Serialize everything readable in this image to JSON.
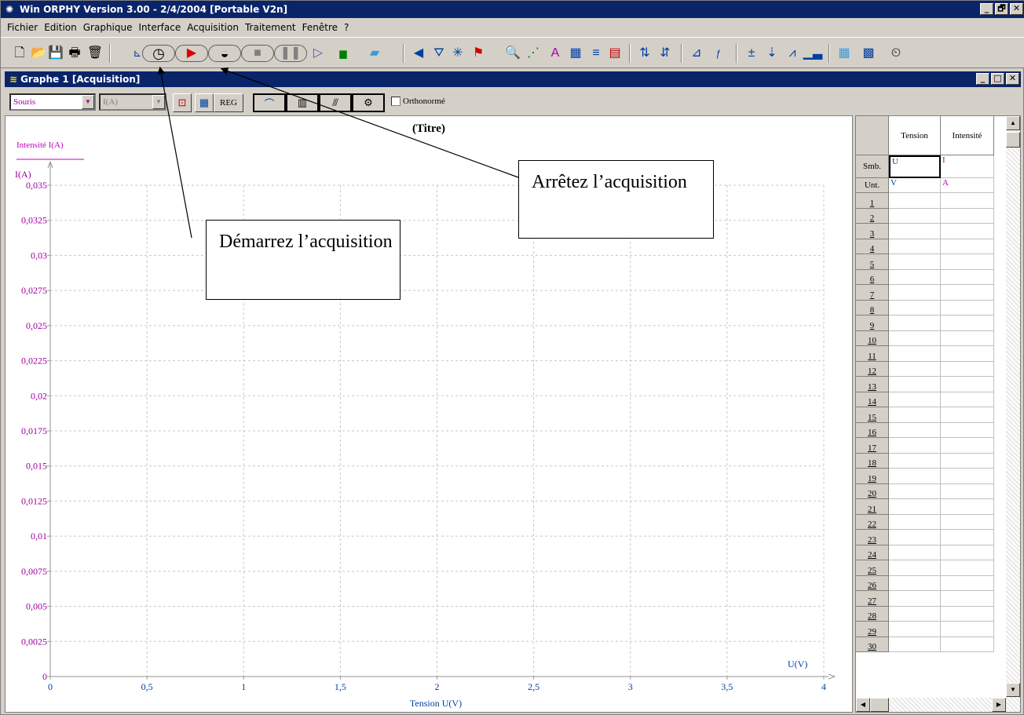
{
  "window": {
    "title": "Win ORPHY Version 3.00 - 2/4/2004  [Portable V2n]",
    "buttons": [
      "_",
      "🗗",
      "✕"
    ]
  },
  "menu": [
    "Fichier",
    "Edition",
    "Graphique",
    "Interface",
    "Acquisition",
    "Traitement",
    "Fenêtre",
    "?"
  ],
  "toolbar": {
    "icons": [
      "new-icon",
      "open-icon",
      "save-icon",
      "print-icon",
      "trash-icon",
      "start-acquisition-icon",
      "play-icon",
      "stop-acquisition-icon",
      "stop-icon",
      "pause-icon",
      "step-icon",
      "display-icon",
      "calibrate-icon",
      "cursor-icon",
      "marker-icon",
      "star-icon",
      "flag-icon",
      "zoom-icon",
      "model-icon",
      "text-icon",
      "table-icon",
      "equation-icon",
      "scale-icon",
      "derive-icon",
      "integrate-icon",
      "chart-icon",
      "function-icon",
      "calc-icon",
      "sort-icon",
      "curve-icon",
      "histogram-icon",
      "grid-icon",
      "clock-icon"
    ]
  },
  "graph_window": {
    "title": "Graphe 1 [Acquisition]",
    "mode_select": "Souris",
    "variable_select": "I(A)",
    "reg_label": "REG",
    "orthonormal_label": "Orthonormé"
  },
  "chart_data": {
    "type": "scatter",
    "title": "(Titre)",
    "xlabel": "Tension U(V)",
    "ylabel": "Intensité I(A)",
    "x_unit_label": "U(V)",
    "y_unit_label": "I(A)",
    "xlim": [
      0,
      4
    ],
    "ylim": [
      0,
      0.035
    ],
    "x_ticks": [
      "0",
      "0,5",
      "1",
      "1,5",
      "2",
      "2,5",
      "3",
      "3,5",
      "4"
    ],
    "y_ticks": [
      "0",
      "0,0025",
      "0,005",
      "0,0075",
      "0,01",
      "0,0125",
      "0,015",
      "0,0175",
      "0,02",
      "0,0225",
      "0,025",
      "0,0275",
      "0,03",
      "0,0325",
      "0,035"
    ],
    "grid": true,
    "series": []
  },
  "table": {
    "columns": [
      "Tension",
      "Intensité"
    ],
    "symbol_label": "Smb.",
    "unit_label": "Unt.",
    "symbols": [
      "U",
      "I"
    ],
    "units": [
      "V",
      "A"
    ],
    "rows": [
      "1",
      "2",
      "3",
      "4",
      "5",
      "6",
      "7",
      "8",
      "9",
      "10",
      "11",
      "12",
      "13",
      "14",
      "15",
      "16",
      "17",
      "18",
      "19",
      "20",
      "21",
      "22",
      "23",
      "24",
      "25",
      "26",
      "27",
      "28",
      "29",
      "30"
    ]
  },
  "callouts": {
    "start": "Démarrez l’acquisition",
    "stop": "Arrêtez l’acquisition"
  }
}
